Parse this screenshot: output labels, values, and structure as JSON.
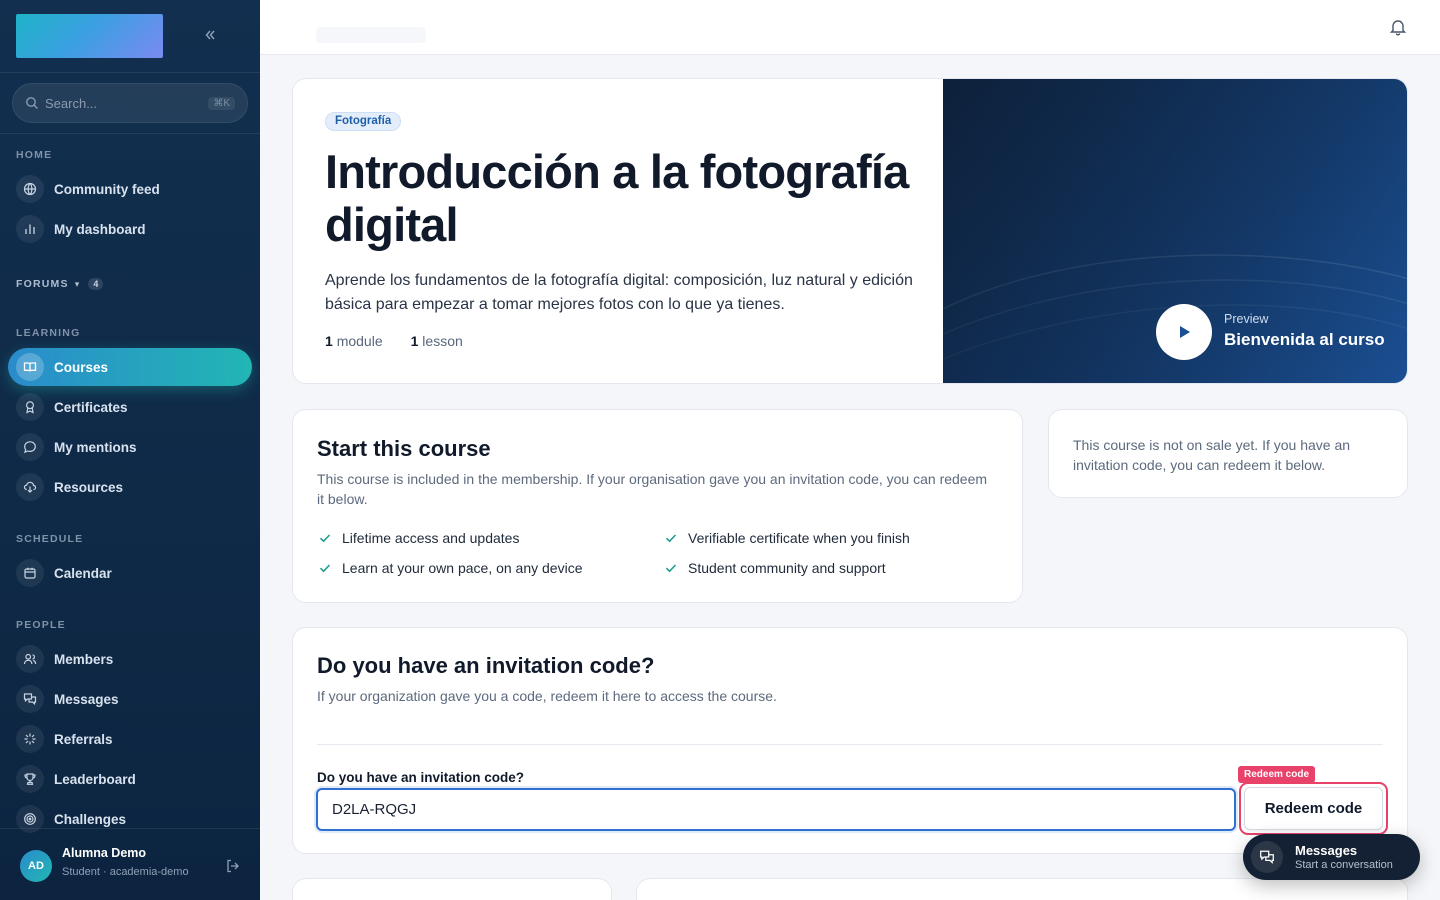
{
  "sidebar": {
    "collapse_icon": "chevrons-left-icon",
    "search": {
      "placeholder": "Search...",
      "shortcut": "⌘K"
    },
    "sections": {
      "home": "HOME",
      "forums": "FORUMS",
      "forums_count": "4",
      "learning": "LEARNING",
      "schedule": "SCHEDULE",
      "people": "PEOPLE"
    },
    "items": [
      {
        "label": "Community feed",
        "icon": "globe-icon"
      },
      {
        "label": "My dashboard",
        "icon": "bar-chart-icon"
      },
      {
        "label": "Courses",
        "icon": "book-open-icon",
        "active": true
      },
      {
        "label": "Certificates",
        "icon": "award-icon"
      },
      {
        "label": "My mentions",
        "icon": "message-circle-icon"
      },
      {
        "label": "Resources",
        "icon": "cloud-download-icon"
      },
      {
        "label": "Calendar",
        "icon": "calendar-icon"
      },
      {
        "label": "Members",
        "icon": "users-icon"
      },
      {
        "label": "Messages",
        "icon": "messages-icon"
      },
      {
        "label": "Referrals",
        "icon": "sparkle-icon"
      },
      {
        "label": "Leaderboard",
        "icon": "trophy-icon"
      },
      {
        "label": "Challenges",
        "icon": "target-icon"
      }
    ],
    "user": {
      "initials": "AD",
      "name": "Alumna Demo",
      "role": "Student · academia-demo"
    }
  },
  "colors": {
    "accent": "#2a8ccb",
    "accent2": "#22b6b4",
    "sidebar_bg": "#0f2a47",
    "highlight": "#e8426b",
    "focus": "#2f6fd0"
  },
  "hero": {
    "tag": "Fotografía",
    "title": "Introducción a la fotografía digital",
    "description": "Aprende los fundamentos de la fotografía digital: composición, luz natural y edición básica para empezar a tomar mejores fotos con lo que ya tienes.",
    "modules_count": "1",
    "modules_label": "module",
    "lessons_count": "1",
    "lessons_label": "lesson",
    "preview_label": "Preview",
    "preview_title": "Bienvenida al curso"
  },
  "start": {
    "title": "Start this course",
    "description": "This course is included in the membership. If your organisation gave you an invitation code, you can redeem it below.",
    "features": [
      "Lifetime access and updates",
      "Verifiable certificate when you finish",
      "Learn at your own pace, on any device",
      "Student community and support"
    ]
  },
  "not_on_sale": "This course is not on sale yet. If you have an invitation code, you can redeem it below.",
  "invite": {
    "title": "Do you have an invitation code?",
    "subtitle": "If your organization gave you a code, redeem it here to access the course.",
    "field_label": "Do you have an invitation code?",
    "code_value": "D2LA-RQGJ",
    "button_label": "Redeem code",
    "highlight_tag": "Redeem code"
  },
  "messages_widget": {
    "title": "Messages",
    "subtitle": "Start a conversation"
  }
}
